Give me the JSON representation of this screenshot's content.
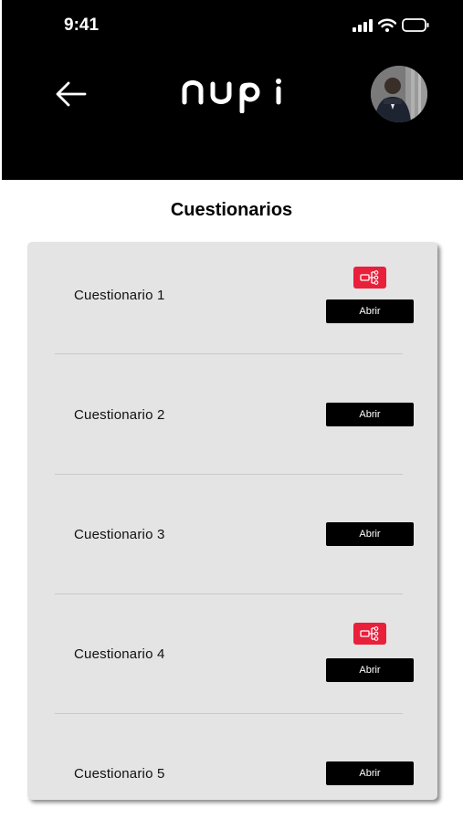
{
  "status_bar": {
    "time": "9:41",
    "icons": [
      "signal-icon",
      "wifi-icon",
      "battery-icon"
    ]
  },
  "header": {
    "back_icon": "arrow-left-icon",
    "logo_text": "nupi",
    "avatar": "user-avatar"
  },
  "page": {
    "title": "Cuestionarios"
  },
  "questionnaires": [
    {
      "label": "Cuestionario 1",
      "button": "Abrir",
      "has_flow_badge": true
    },
    {
      "label": "Cuestionario 2",
      "button": "Abrir",
      "has_flow_badge": false
    },
    {
      "label": "Cuestionario 3",
      "button": "Abrir",
      "has_flow_badge": false
    },
    {
      "label": "Cuestionario 4",
      "button": "Abrir",
      "has_flow_badge": true
    },
    {
      "label": "Cuestionario 5",
      "button": "Abrir",
      "has_flow_badge": false
    }
  ],
  "colors": {
    "header_bg": "#000000",
    "card_bg": "#e4e4e4",
    "accent": "#e9203a",
    "button_bg": "#000000",
    "button_text": "#ffffff"
  }
}
